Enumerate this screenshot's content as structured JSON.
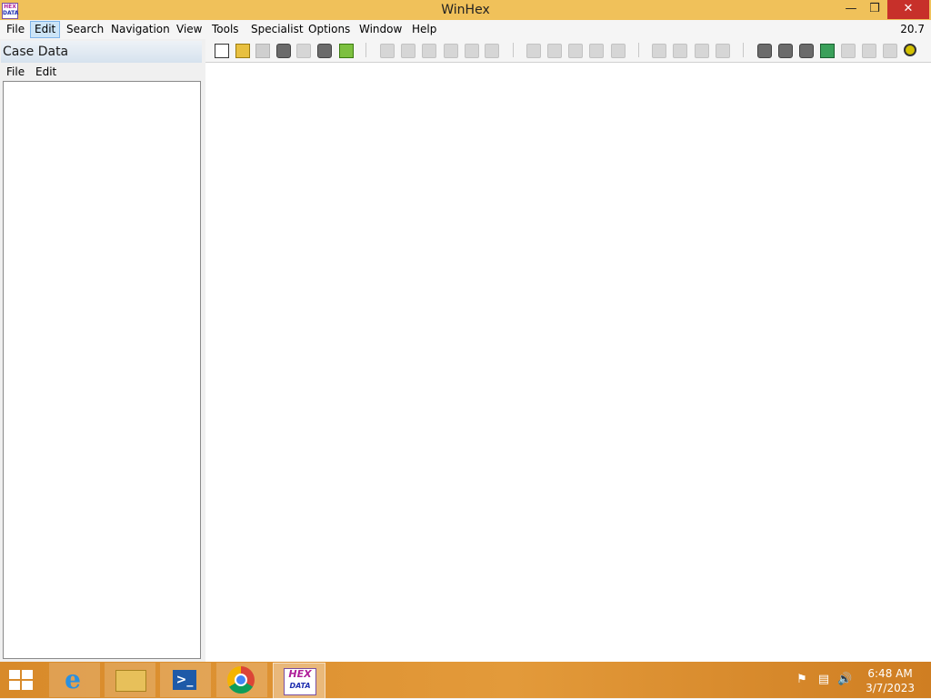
{
  "window": {
    "title": "WinHex",
    "version": "20.7",
    "minimize_glyph": "—",
    "restore_glyph": "❒",
    "close_glyph": "✕",
    "logo_top": "HEX",
    "logo_bottom": "DATA"
  },
  "menubar": {
    "items": [
      "File",
      "Edit",
      "Search",
      "Navigation",
      "View",
      "Tools",
      "Specialist",
      "Options",
      "Window",
      "Help"
    ],
    "active": "Edit"
  },
  "case_panel": {
    "title": "Case Data",
    "menu": [
      "File",
      "Edit"
    ]
  },
  "toolbar": {
    "icons": [
      "new-file-icon",
      "open-folder-icon",
      "save-icon",
      "print-icon",
      "scissors-icon",
      "properties-icon",
      "export-icon",
      "undo-icon",
      "copy-icon",
      "paste-icon",
      "clipboard-icon",
      "multi-copy-icon",
      "binary-icon",
      "find-text-icon",
      "find-hex-icon",
      "replace-text-icon",
      "replace-hex-icon",
      "find-special-icon",
      "goto-offset-icon",
      "goto-sector-icon",
      "back-icon",
      "forward-icon",
      "open-disk-icon",
      "open-ram-icon",
      "hand-icon",
      "calculator-icon",
      "search-icon",
      "cloud-icon",
      "chart-icon",
      "settings-icon"
    ]
  },
  "taskbar": {
    "start_icon": "windows-logo-icon",
    "apps": [
      "internet-explorer-icon",
      "file-explorer-icon",
      "powershell-icon",
      "chrome-icon",
      "winhex-icon"
    ],
    "ie_glyph": "e",
    "ps_glyph": ">_",
    "hex_top": "HEX",
    "hex_bottom": "DATA",
    "clock_time": "6:48 AM",
    "clock_date": "3/7/2023"
  },
  "colors": {
    "titlebar": "#f0c15a",
    "close_button": "#c7302a",
    "taskbar": "#e39a3a",
    "menu_highlight": "#cce4f7"
  }
}
